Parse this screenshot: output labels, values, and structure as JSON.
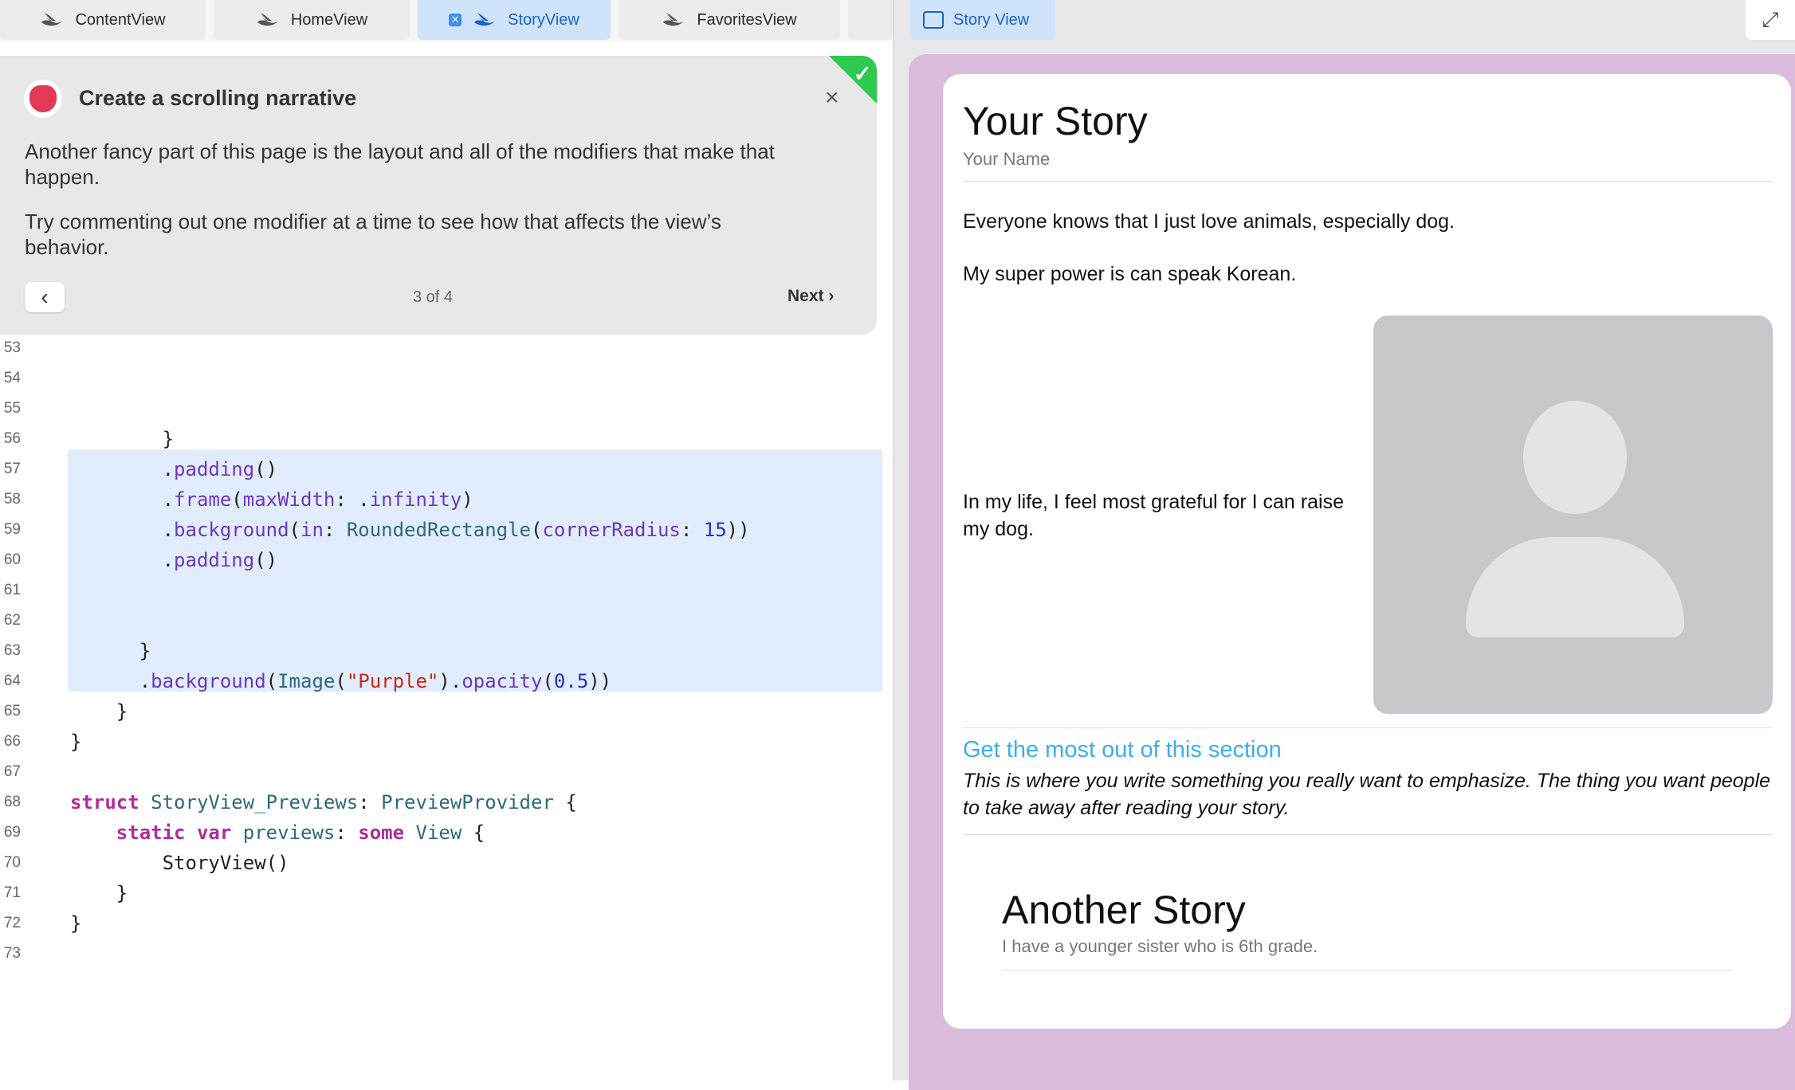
{
  "editor": {
    "tabs": [
      {
        "label": "ContentView"
      },
      {
        "label": "HomeView"
      },
      {
        "label": "StoryView"
      },
      {
        "label": "FavoritesView"
      }
    ]
  },
  "tutorial": {
    "title": "Create a scrolling narrative",
    "paragraph1": "Another fancy part of this page is the layout and all of the modifiers that make that happen.",
    "paragraph2": "Try commenting out one modifier at a time to see how that affects the view’s behavior.",
    "pager": "3 of 4",
    "next_label": "Next"
  },
  "code_lines": [
    {
      "n": "53"
    },
    {
      "n": "54"
    },
    {
      "n": "55"
    },
    {
      "n": "56"
    },
    {
      "n": "57"
    },
    {
      "n": "58"
    },
    {
      "n": "59"
    },
    {
      "n": "60"
    },
    {
      "n": "61"
    },
    {
      "n": "62"
    },
    {
      "n": "63"
    },
    {
      "n": "64"
    },
    {
      "n": "65"
    },
    {
      "n": "66"
    },
    {
      "n": "67"
    },
    {
      "n": "68"
    },
    {
      "n": "69"
    },
    {
      "n": "70"
    },
    {
      "n": "71"
    },
    {
      "n": "72"
    },
    {
      "n": "73"
    }
  ],
  "preview": {
    "tab_label": "Story View",
    "story_title": "Your Story",
    "story_name": "Your Name",
    "line1": "Everyone knows that I just love animals, especially dog.",
    "line2": "My super power is can speak Korean.",
    "line3": "In my life, I feel most grateful for I can raise my dog.",
    "section_heading": "Get the most out of this section",
    "section_body": "This is where you write something you really want to emphasize. The thing you want people to take away after reading your story.",
    "another_title": "Another Story",
    "another_sub": "I have a younger sister who is 6th grade."
  },
  "colors": {
    "accent": "#1f63c9",
    "highlight": "#e1ecfc",
    "preview_background": "#dcbcdc",
    "link": "#3eaee8",
    "success": "#2ec94f"
  },
  "icons": [
    "swift-icon",
    "close-icon",
    "chevron-left-icon",
    "chevron-right-icon",
    "checkmark-icon",
    "expand-icon",
    "person-placeholder-icon",
    "stack-icon"
  ]
}
